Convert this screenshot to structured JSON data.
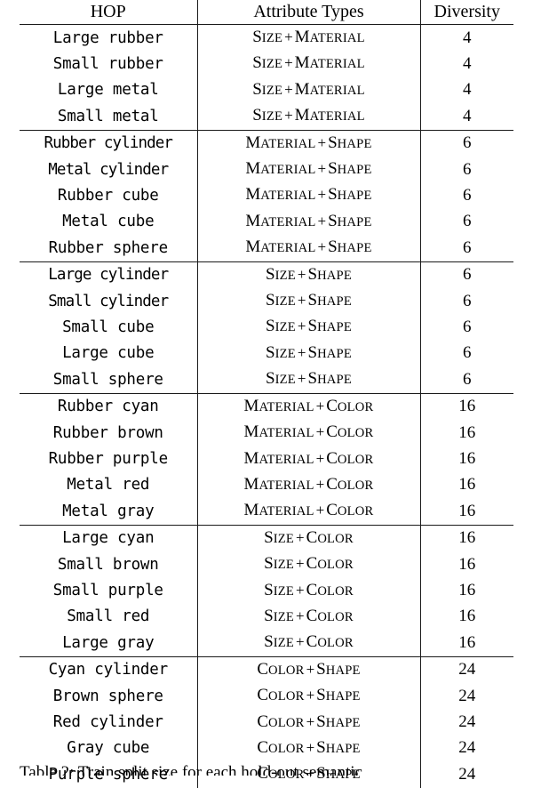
{
  "table": {
    "headers": {
      "hop": "HOP",
      "attribute_types": "Attribute Types",
      "diversity": "Diversity"
    },
    "groups": [
      {
        "attribute_type": {
          "first": "Size",
          "second": "Material"
        },
        "diversity": "4",
        "rows": [
          {
            "hop": "Large rubber",
            "attr_first": "Size",
            "attr_second": "Material",
            "diversity": "4"
          },
          {
            "hop": "Small rubber",
            "attr_first": "Size",
            "attr_second": "Material",
            "diversity": "4"
          },
          {
            "hop": "Large metal",
            "attr_first": "Size",
            "attr_second": "Material",
            "diversity": "4"
          },
          {
            "hop": "Small metal",
            "attr_first": "Size",
            "attr_second": "Material",
            "diversity": "4"
          }
        ]
      },
      {
        "attribute_type": {
          "first": "Material",
          "second": "Shape"
        },
        "diversity": "6",
        "rows": [
          {
            "hop": "Rubber cylinder",
            "attr_first": "Material",
            "attr_second": "Shape",
            "diversity": "6"
          },
          {
            "hop": "Metal cylinder",
            "attr_first": "Material",
            "attr_second": "Shape",
            "diversity": "6"
          },
          {
            "hop": "Rubber cube",
            "attr_first": "Material",
            "attr_second": "Shape",
            "diversity": "6"
          },
          {
            "hop": "Metal cube",
            "attr_first": "Material",
            "attr_second": "Shape",
            "diversity": "6"
          },
          {
            "hop": "Rubber sphere",
            "attr_first": "Material",
            "attr_second": "Shape",
            "diversity": "6"
          }
        ]
      },
      {
        "attribute_type": {
          "first": "Size",
          "second": "Shape"
        },
        "diversity": "6",
        "rows": [
          {
            "hop": "Large cylinder",
            "attr_first": "Size",
            "attr_second": "Shape",
            "diversity": "6"
          },
          {
            "hop": "Small cylinder",
            "attr_first": "Size",
            "attr_second": "Shape",
            "diversity": "6"
          },
          {
            "hop": "Small cube",
            "attr_first": "Size",
            "attr_second": "Shape",
            "diversity": "6"
          },
          {
            "hop": "Large cube",
            "attr_first": "Size",
            "attr_second": "Shape",
            "diversity": "6"
          },
          {
            "hop": "Small sphere",
            "attr_first": "Size",
            "attr_second": "Shape",
            "diversity": "6"
          }
        ]
      },
      {
        "attribute_type": {
          "first": "Material",
          "second": "Color"
        },
        "diversity": "16",
        "rows": [
          {
            "hop": "Rubber cyan",
            "attr_first": "Material",
            "attr_second": "Color",
            "diversity": "16"
          },
          {
            "hop": "Rubber brown",
            "attr_first": "Material",
            "attr_second": "Color",
            "diversity": "16"
          },
          {
            "hop": "Rubber purple",
            "attr_first": "Material",
            "attr_second": "Color",
            "diversity": "16"
          },
          {
            "hop": "Metal red",
            "attr_first": "Material",
            "attr_second": "Color",
            "diversity": "16"
          },
          {
            "hop": "Metal gray",
            "attr_first": "Material",
            "attr_second": "Color",
            "diversity": "16"
          }
        ]
      },
      {
        "attribute_type": {
          "first": "Size",
          "second": "Color"
        },
        "diversity": "16",
        "rows": [
          {
            "hop": "Large cyan",
            "attr_first": "Size",
            "attr_second": "Color",
            "diversity": "16"
          },
          {
            "hop": "Small brown",
            "attr_first": "Size",
            "attr_second": "Color",
            "diversity": "16"
          },
          {
            "hop": "Small purple",
            "attr_first": "Size",
            "attr_second": "Color",
            "diversity": "16"
          },
          {
            "hop": "Small red",
            "attr_first": "Size",
            "attr_second": "Color",
            "diversity": "16"
          },
          {
            "hop": "Large gray",
            "attr_first": "Size",
            "attr_second": "Color",
            "diversity": "16"
          }
        ]
      },
      {
        "attribute_type": {
          "first": "Color",
          "second": "Shape"
        },
        "diversity": "24",
        "rows": [
          {
            "hop": "Cyan cylinder",
            "attr_first": "Color",
            "attr_second": "Shape",
            "diversity": "24"
          },
          {
            "hop": "Brown sphere",
            "attr_first": "Color",
            "attr_second": "Shape",
            "diversity": "24"
          },
          {
            "hop": "Red cylinder",
            "attr_first": "Color",
            "attr_second": "Shape",
            "diversity": "24"
          },
          {
            "hop": "Gray cube",
            "attr_first": "Color",
            "attr_second": "Shape",
            "diversity": "24"
          },
          {
            "hop": "Purple sphere",
            "attr_first": "Color",
            "attr_second": "Shape",
            "diversity": "24"
          }
        ]
      }
    ],
    "plus_symbol": "+"
  },
  "caption": {
    "text": "Table 2: Train split size for each hold-out semantic"
  },
  "colors": {
    "rule": "#1a1a1a",
    "text": "#000000",
    "background": "#ffffff"
  }
}
